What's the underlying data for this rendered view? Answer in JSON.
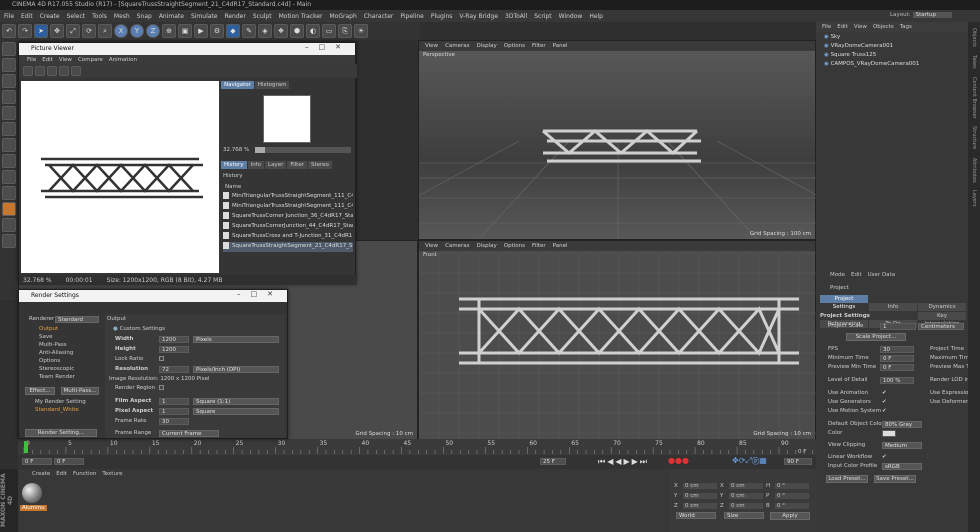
{
  "app": {
    "title": "CINEMA 4D R17.055 Studio (R17) - [SquareTrussStraightSegment_21_C4dR17_Standard.c4d] - Main",
    "layout_label": "Layout:",
    "layout_value": "Startup"
  },
  "menu": [
    "File",
    "Edit",
    "Create",
    "Select",
    "Tools",
    "Mesh",
    "Snap",
    "Animate",
    "Simulate",
    "Render",
    "Sculpt",
    "Motion Tracker",
    "MoGraph",
    "Character",
    "Pipeline",
    "Plugins",
    "V-Ray Bridge",
    "3DToAll",
    "Script",
    "Window",
    "Help"
  ],
  "toolbar": {
    "x_label": "X",
    "y_label": "Y",
    "z_label": "Z"
  },
  "viewport_menu": [
    "View",
    "Cameras",
    "Display",
    "Options",
    "Filter",
    "Panel"
  ],
  "viewports": {
    "perspective": {
      "label": "Perspective",
      "grid": "Grid Spacing : 100 cm"
    },
    "front": {
      "label": "Front",
      "grid": "Grid Spacing : 10 cm"
    },
    "top_left_grid": "Grid Spacing : 100 cm",
    "bottom_left_grid": "Grid Spacing : 10 cm"
  },
  "object_manager": {
    "menu": [
      "File",
      "Edit",
      "View",
      "Objects",
      "Tags"
    ],
    "items": [
      "Sky",
      "VRayDomeCamera001",
      "Square Truss125",
      "CAMPOS_VRayDomeCamera001"
    ]
  },
  "picture_viewer": {
    "title": "Picture Viewer",
    "menu": [
      "File",
      "Edit",
      "View",
      "Compare",
      "Animation"
    ],
    "tabs_top": [
      "Navigator",
      "Histogram"
    ],
    "zoom": "32.768 %",
    "tabs_mid": [
      "History",
      "Info",
      "Layer",
      "Filter",
      "Stereo"
    ],
    "history_label": "History",
    "name_col": "Name",
    "history": [
      "MiniTriangularTrussStraightSegment_111_C4",
      "MiniTriangularTrussStraightSegment_111_C4",
      "SquareTrussCorner Junction_36_C4dR17_Star",
      "SquareTrussCornerJunction_44_C4dR17_Star",
      "SquareTrussCross and T-Junction_31_C4dR1",
      "SquareTrussStraightSegment_21_C4dR17_Sta"
    ],
    "status_zoom": "32.768 %",
    "status_time": "00:00:01",
    "status_size": "Size: 1200x1200, RGB (8 Bit), 4.27 MB"
  },
  "render_settings": {
    "title": "Render Settings",
    "renderer_label": "Renderer",
    "renderer_value": "Standard",
    "list": [
      "Output",
      "Save",
      "Multi-Pass",
      "Anti-Aliasing",
      "Options",
      "Stereoscopic",
      "Team Render"
    ],
    "effect_btn": "Effect...",
    "multipass_btn": "Multi-Pass...",
    "settings": [
      "My Render Setting",
      "Standard_White"
    ],
    "render_setting_btn": "Render Setting...",
    "output_header": "Output",
    "custom_settings": "Custom Settings",
    "width_label": "Width",
    "width_value": "1200",
    "width_unit": "Pixels",
    "height_label": "Height",
    "height_value": "1200",
    "lock_ratio": "Lock Ratio",
    "resolution_label": "Resolution",
    "resolution_value": "72",
    "resolution_unit": "Pixels/Inch (DPI)",
    "image_resolution": "Image Resolution: 1200 x 1200 Pixel",
    "render_region": "Render Region",
    "film_aspect_label": "Film Aspect",
    "film_aspect_value": "1",
    "film_aspect_preset": "Square (1:1)",
    "pixel_aspect_label": "Pixel Aspect",
    "pixel_aspect_value": "1",
    "pixel_aspect_preset": "Square",
    "frame_rate_label": "Frame Rate",
    "frame_rate_value": "30",
    "frame_range_label": "Frame Range",
    "frame_range_value": "Current Frame"
  },
  "attributes": {
    "menu": [
      "Mode",
      "Edit",
      "User Data"
    ],
    "project": "Project",
    "tabs": [
      "Project Settings",
      "Info",
      "Dynamics",
      "Referencing",
      "To Do",
      "Key Interpolation"
    ],
    "section": "Project Settings",
    "project_scale_label": "Project Scale",
    "project_scale_value": "1",
    "project_scale_unit": "Centimeters",
    "scale_project_btn": "Scale Project...",
    "fps_label": "FPS",
    "fps_value": "30",
    "project_time_label": "Project Time",
    "min_time_label": "Minimum Time",
    "min_time_value": "0 F",
    "max_time_label": "Maximum Time",
    "preview_min_label": "Preview Min Time",
    "preview_min_value": "0 F",
    "preview_max_label": "Preview Max Tim",
    "lod_label": "Level of Detail",
    "lod_value": "100 %",
    "render_lod_label": "Render LOD in",
    "use_animation": "Use Animation",
    "use_expression": "Use Expression",
    "use_generators": "Use Generators",
    "use_deformers": "Use Deformers",
    "use_motion": "Use Motion System",
    "default_color_label": "Default Object Color",
    "default_color_value": "80% Gray",
    "color_label": "Color",
    "view_clipping_label": "View Clipping",
    "view_clipping_value": "Medium",
    "linear_workflow": "Linear Workflow",
    "input_color_label": "Input Color Profile",
    "input_color_value": "sRGB",
    "load_preset": "Load Preset...",
    "save_preset": "Save Preset..."
  },
  "timeline": {
    "ticks": [
      "0",
      "5",
      "10",
      "15",
      "20",
      "25",
      "30",
      "35",
      "40",
      "45",
      "50",
      "55",
      "60",
      "65",
      "70",
      "75",
      "80",
      "85",
      "90"
    ],
    "tail": [
      "0 F"
    ],
    "start": "0 F",
    "start2": "0 F",
    "end": "90 F",
    "end2": "25 F"
  },
  "material": {
    "menu": [
      "Create",
      "Edit",
      "Function",
      "Texture"
    ],
    "name": "Aluminu"
  },
  "coords": {
    "rows": [
      [
        "X",
        "0 cm",
        "X",
        "0 cm",
        "H",
        "0 °"
      ],
      [
        "Y",
        "0 cm",
        "Y",
        "0 cm",
        "P",
        "0 °"
      ],
      [
        "Z",
        "0 cm",
        "Z",
        "0 cm",
        "B",
        "0 °"
      ]
    ],
    "world": "World",
    "size": "Size",
    "apply": "Apply"
  },
  "side_tabs": [
    "Objects",
    "Takes",
    "Content Browser",
    "Structure",
    "Attributes",
    "Layers"
  ],
  "maxon_logo": "MAXON CINEMA 4D"
}
